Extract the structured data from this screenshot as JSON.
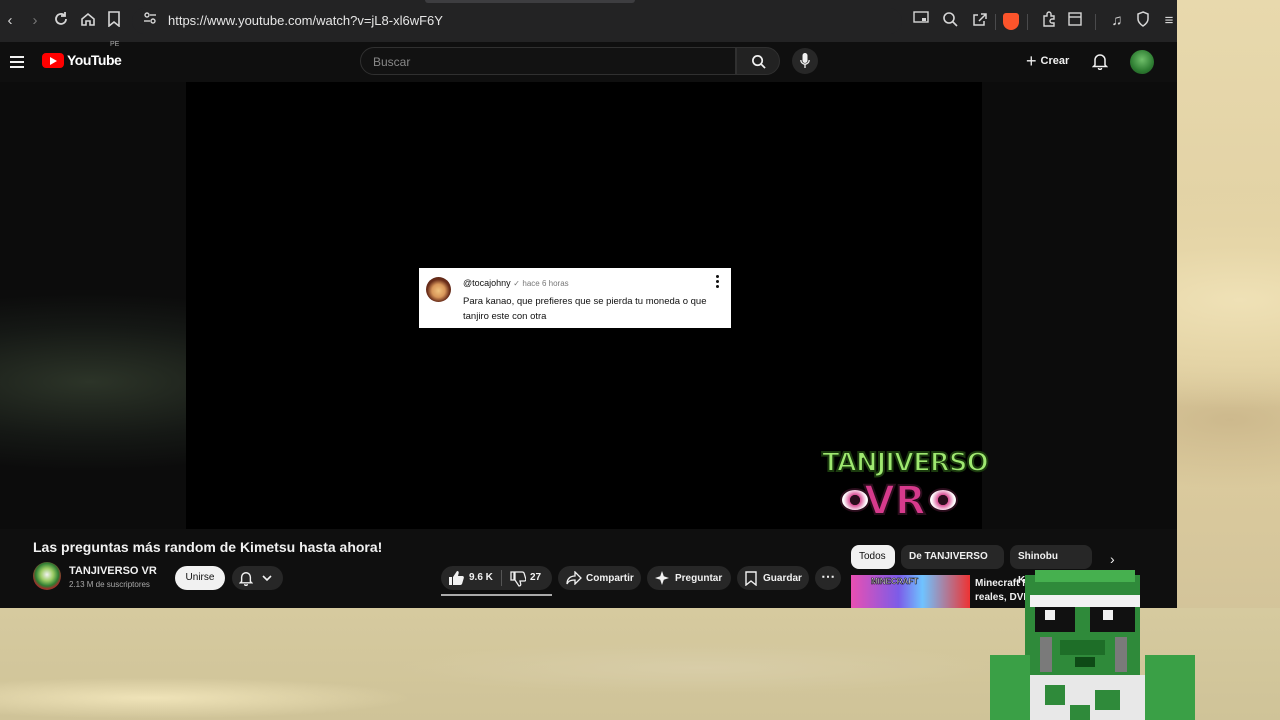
{
  "browser": {
    "url": "https://www.youtube.com/watch?v=jL8-xl6wF6Y"
  },
  "youtube": {
    "logo_text": "YouTube",
    "country_code": "PE",
    "search_placeholder": "Buscar",
    "create_label": "Crear"
  },
  "video": {
    "comment": {
      "username": "@tocajohny",
      "time": "hace 6 horas",
      "text": "Para kanao, que prefieres que se pierda tu moneda o que tanjiro este con otra"
    },
    "watermark_top": "TANJIVERSO",
    "watermark_bottom": "VR"
  },
  "details": {
    "title": "Las preguntas más random de Kimetsu hasta ahora!",
    "channel_name": "TANJIVERSO VR",
    "subscribers": "2.13 M de suscriptores",
    "join_label": "Unirse",
    "likes": "9.6 K",
    "dislikes": "27",
    "share_label": "Compartir",
    "ask_label": "Preguntar",
    "save_label": "Guardar"
  },
  "recommendations": {
    "chips": [
      "Todos",
      "De TANJIVERSO VR",
      "Shinobu Kochō"
    ],
    "first_item": {
      "thumb_label": "MINECRAFT",
      "title": "Minecraft M reales, DVD,"
    }
  },
  "colors": {
    "yt_red": "#ff0000",
    "bg_dark": "#0f0f0f",
    "brave_orange": "#fb542b"
  }
}
